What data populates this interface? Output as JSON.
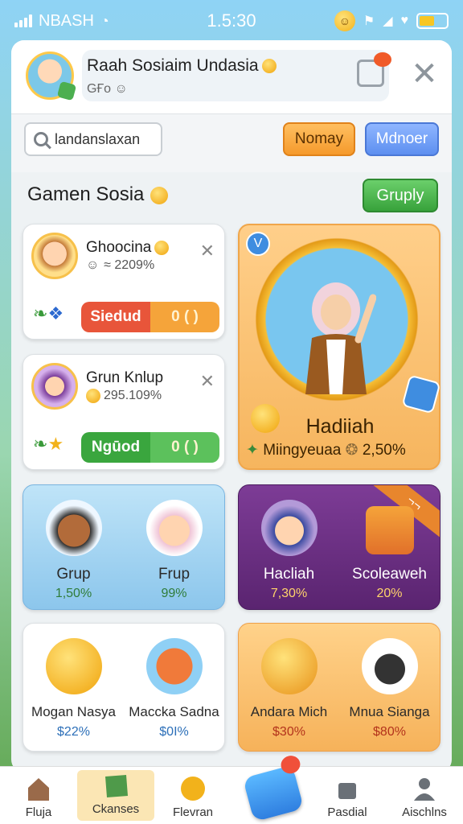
{
  "status_bar": {
    "carrier": "NBASH",
    "time": "1.5:30"
  },
  "header": {
    "title": "Raah Sosiaim Undasia",
    "subtitle": "GҒo"
  },
  "search": {
    "value": "landanslaxan",
    "filter_orange": "Nomay",
    "filter_blue": "Mdnoer"
  },
  "section": {
    "title": "Gamen Sosia",
    "group_button": "Gruply"
  },
  "friends": [
    {
      "name": "Ghoocina",
      "stat": "☺  ≈ 2209%",
      "action_label": "Siedud",
      "action_value": "0 ( )"
    },
    {
      "name": "Grun Knlup",
      "stat": "295.109%",
      "action_label": "Ngūod",
      "action_value": "0 ( )"
    }
  ],
  "hero": {
    "name": "Hadiiah",
    "subtitle": "Miingyeuaa",
    "value": "2,50%"
  },
  "tiles": [
    {
      "left_name": "Grup",
      "left_value": "1,50%",
      "right_name": "Frup",
      "right_value": "99%"
    },
    {
      "left_name": "Hacliah",
      "left_value": "7,30%",
      "right_name": "Scoleaweh",
      "right_value": "20%",
      "ribbon": "¬¬"
    },
    {
      "left_name": "Mogan Nasya",
      "left_value": "$22%",
      "right_name": "Macckа Sadna",
      "right_value": "$0I%"
    },
    {
      "left_name": "Andara Mich",
      "left_value": "$30%",
      "right_name": "Mnua Sianga",
      "right_value": "$80%"
    }
  ],
  "bottom_nav": [
    {
      "label": "Fluja"
    },
    {
      "label": "Ckanses"
    },
    {
      "label": "Flevran"
    },
    {
      "label": ""
    },
    {
      "label": "Pasdial"
    },
    {
      "label": "Aischlns"
    }
  ],
  "colors": {
    "accent_orange": "#f59a2c",
    "accent_blue": "#5d8ff0",
    "accent_green": "#38a23b",
    "purple_card": "#6a2f7e"
  }
}
